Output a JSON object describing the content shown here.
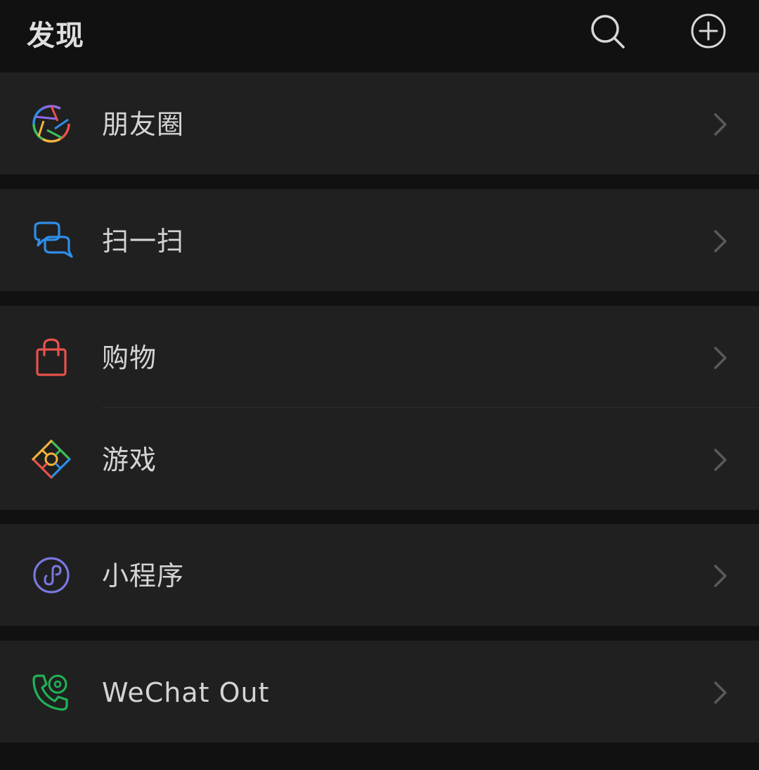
{
  "header": {
    "title": "发现",
    "search_icon": "search-icon",
    "add_icon": "add-circle-icon"
  },
  "items": [
    {
      "label": "朋友圈",
      "icon": "moments-icon"
    },
    {
      "label": "扫一扫",
      "icon": "scan-icon"
    },
    {
      "label": "购物",
      "icon": "shopping-bag-icon"
    },
    {
      "label": "游戏",
      "icon": "games-icon"
    },
    {
      "label": "小程序",
      "icon": "mini-programs-icon"
    },
    {
      "label": "WeChat Out",
      "icon": "wechat-out-icon"
    }
  ],
  "colors": {
    "background": "#111111",
    "row_background": "#202020",
    "text": "#d4d4d4",
    "chevron": "#5a5a5a",
    "scan_blue": "#2f8ee8",
    "shopping_red": "#e8524a",
    "mini_purple": "#7a78e0",
    "wechat_out_green": "#1fb356"
  }
}
